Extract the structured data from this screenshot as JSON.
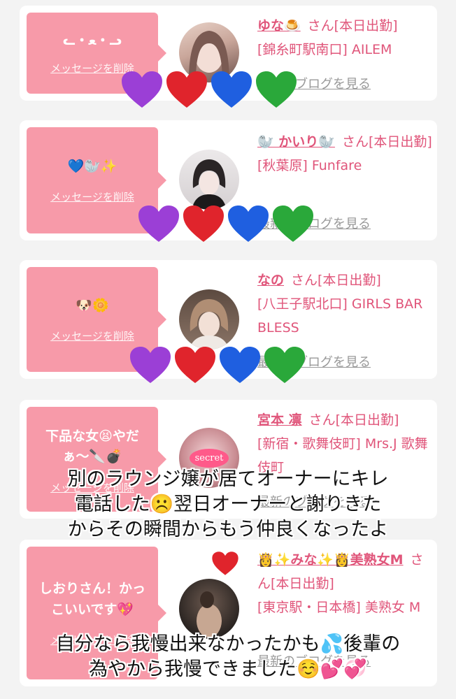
{
  "entries": [
    {
      "message": "ᓚ・ﻌ・ᓗ",
      "delete_label": "メッセージを削除",
      "name": "ゆな🍮",
      "suffix": "さん[本日出勤]",
      "location": "[錦糸町駅南口] AILEM",
      "blog_label": "最新のブログを見る"
    },
    {
      "message": "💙🦭✨",
      "delete_label": "メッセージを削除",
      "name": "🦭 かいり🦭",
      "suffix": "さん[本日出勤]",
      "location": "[秋葉原] Funfare",
      "blog_label": "最新のブログを見る"
    },
    {
      "message": "🐶🌼",
      "delete_label": "メッセージを削除",
      "name": "なの",
      "suffix": "さん[本日出勤]",
      "location": "[八王子駅北口] GIRLS BAR BLESS",
      "blog_label": "最新のブログを見る"
    },
    {
      "message": "下品な女😫やだぁ〜🔪💣",
      "delete_label": "メッセージを削除",
      "name": "宮本 凛",
      "suffix": "さん[本日出勤]",
      "location": "[新宿・歌舞伎町] Mrs.J 歌舞伎町",
      "blog_label": "最新のブログを見る",
      "avatar_text": "secret"
    },
    {
      "message": "しおりさん！かっこいいです💖",
      "delete_label": "メッセージを削除",
      "name": "👸✨みな✨👸美熟女M",
      "suffix": "さん[本日出勤]",
      "location": "[東京駅・日本橋] 美熟女 M",
      "blog_label": "最新のブログを見る"
    }
  ],
  "overlay_texts": {
    "first": "別のラウンジ嬢が居てオーナーにキレ\n電話した☹️翌日オーナーと謝りきた\nからその瞬間からもう仲良くなったよ",
    "second": "自分なら我慢出来なかったかも💦後輩の\n為やから我慢できました☺️💕💞"
  },
  "colors": {
    "bubble": "#f79aa9",
    "name_link": "#e0557a",
    "heart_purple": "#9b3fd6",
    "heart_red": "#e0242c",
    "heart_blue": "#1f5fe0",
    "heart_green": "#2aa83a"
  }
}
